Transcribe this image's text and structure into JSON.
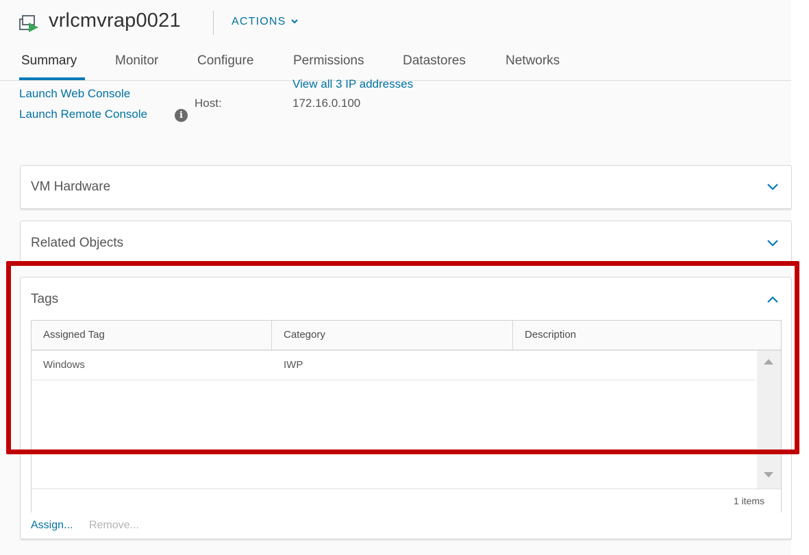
{
  "header": {
    "icon": "vm-icon",
    "title": "vrlcmvrap0021",
    "actions_label": "ACTIONS",
    "actions_icon": "chevron-down-icon"
  },
  "tabs": [
    {
      "label": "Summary",
      "active": true
    },
    {
      "label": "Monitor"
    },
    {
      "label": "Configure"
    },
    {
      "label": "Permissions"
    },
    {
      "label": "Datastores"
    },
    {
      "label": "Networks"
    }
  ],
  "summary": {
    "launch_web_console": "Launch Web Console",
    "launch_remote_console": "Launch Remote Console",
    "info_icon": "info-icon",
    "view_ip": "View all 3 IP addresses",
    "host_label": "Host:",
    "host_value": "172.16.0.100"
  },
  "cards": {
    "vm_hardware": {
      "title": "VM Hardware",
      "icon": "chevron-down-icon"
    },
    "related_objects": {
      "title": "Related Objects",
      "icon": "chevron-down-icon"
    },
    "tags": {
      "title": "Tags",
      "icon": "chevron-up-icon",
      "columns": [
        "Assigned Tag",
        "Category",
        "Description"
      ],
      "rows": [
        {
          "assigned_tag": "Windows",
          "category": "IWP",
          "description": ""
        }
      ],
      "footer_count": "1 items",
      "assign_label": "Assign...",
      "remove_label": "Remove..."
    }
  },
  "colors": {
    "accent": "#0079b8",
    "link": "#0072a3",
    "highlight": "#c00000",
    "disabled": "#b3b3b3"
  }
}
